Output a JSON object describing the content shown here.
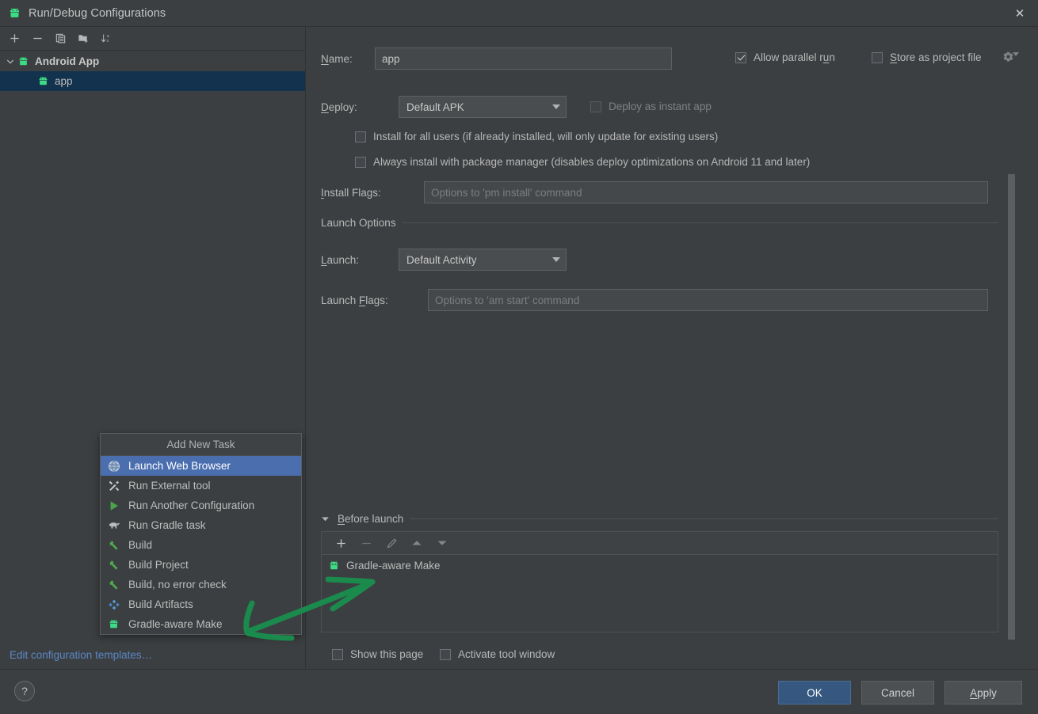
{
  "window": {
    "title": "Run/Debug Configurations",
    "icon": "android-icon",
    "close_label": "✕"
  },
  "sidebar": {
    "toolbar": [
      {
        "name": "add-configuration-button",
        "glyph": "+"
      },
      {
        "name": "remove-configuration-button",
        "glyph": "−"
      },
      {
        "name": "copy-configuration-button",
        "glyph": "copy-icon"
      },
      {
        "name": "new-folder-button",
        "glyph": "folder-add-icon"
      },
      {
        "name": "sort-alphabetically-button",
        "glyph": "sort-az-icon"
      }
    ],
    "tree": [
      {
        "label": "Android App",
        "type": "group",
        "expanded": true,
        "selected": false
      },
      {
        "label": "app",
        "type": "child",
        "selected": true
      }
    ],
    "edit_templates_link": "Edit configuration templates…"
  },
  "form": {
    "name_label": "Name:",
    "name_value": "app",
    "allow_parallel_run": {
      "label": "Allow parallel run",
      "checked": true
    },
    "store_as_project_file": {
      "label": "Store as project file",
      "checked": false
    },
    "deploy_label": "Deploy:",
    "deploy_value": "Default APK",
    "deploy_as_instant_app": {
      "label": "Deploy as instant app",
      "checked": false,
      "disabled": true
    },
    "install_for_all_users": {
      "label": "Install for all users (if already installed, will only update for existing users)",
      "checked": false
    },
    "always_install_with_package_manager": {
      "label": "Always install with package manager (disables deploy optimizations on Android 11 and later)",
      "checked": false
    },
    "install_flags_label": "Install Flags:",
    "install_flags_placeholder": "Options to 'pm install' command",
    "install_flags_value": "",
    "launch_options_section": "Launch Options",
    "launch_label": "Launch:",
    "launch_value": "Default Activity",
    "launch_flags_label": "Launch Flags:",
    "launch_flags_placeholder": "Options to 'am start' command",
    "launch_flags_value": ""
  },
  "before_launch": {
    "section_label": "Before launch",
    "expanded": true,
    "toolbar": [
      {
        "name": "add-task-button",
        "glyph": "+",
        "enabled": true
      },
      {
        "name": "remove-task-button",
        "glyph": "−",
        "enabled": false
      },
      {
        "name": "edit-task-button",
        "glyph": "pencil-icon",
        "enabled": false
      },
      {
        "name": "move-up-button",
        "glyph": "triangle-up-icon",
        "enabled": false
      },
      {
        "name": "move-down-button",
        "glyph": "triangle-down-icon",
        "enabled": false
      }
    ],
    "tasks": [
      {
        "label": "Gradle-aware Make",
        "icon": "android-icon"
      }
    ],
    "show_this_page": {
      "label": "Show this page",
      "checked": false
    },
    "activate_tool_window": {
      "label": "Activate tool window",
      "checked": false
    }
  },
  "add_new_task_popup": {
    "title": "Add New Task",
    "items": [
      {
        "label": "Launch Web Browser",
        "icon": "globe-icon",
        "selected": true
      },
      {
        "label": "Run External tool",
        "icon": "tools-icon",
        "selected": false
      },
      {
        "label": "Run Another Configuration",
        "icon": "play-icon",
        "selected": false
      },
      {
        "label": "Run Gradle task",
        "icon": "gradle-elephant-icon",
        "selected": false
      },
      {
        "label": "Build",
        "icon": "hammer-icon",
        "selected": false
      },
      {
        "label": "Build Project",
        "icon": "hammer-icon",
        "selected": false
      },
      {
        "label": "Build, no error check",
        "icon": "hammer-icon",
        "selected": false
      },
      {
        "label": "Build Artifacts",
        "icon": "artifacts-icon",
        "selected": false
      },
      {
        "label": "Gradle-aware Make",
        "icon": "android-icon",
        "selected": false
      }
    ]
  },
  "footer": {
    "help_label": "?",
    "ok_label": "OK",
    "cancel_label": "Cancel",
    "apply_label": "Apply"
  },
  "annotation": {
    "type": "hand-drawn-arrow",
    "color": "#1a8a4d",
    "description": "green arrow pointing from Before launch list to Gradle-aware Make menu item"
  },
  "colors": {
    "background": "#3c3f41",
    "selection_blue": "#4b6eaf",
    "tree_selection": "#13324d",
    "primary_button": "#365880",
    "link": "#5a87c4",
    "annotation_green": "#1a8a4d"
  }
}
